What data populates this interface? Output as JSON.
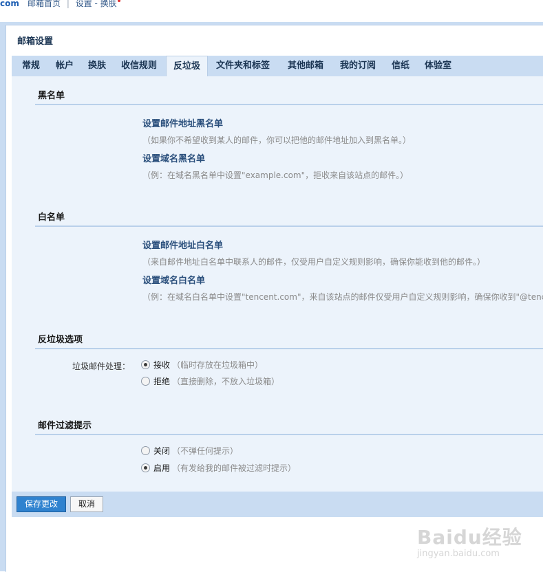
{
  "topbar": {
    "logo_tail": "com",
    "nav": [
      "邮箱首页",
      "设置 - 换肤"
    ],
    "separator": "|"
  },
  "page_title": "邮箱设置",
  "tabs": [
    {
      "label": "常规",
      "active": false
    },
    {
      "label": "帐户",
      "active": false
    },
    {
      "label": "换肤",
      "active": false
    },
    {
      "label": "收信规则",
      "active": false
    },
    {
      "label": "反垃圾",
      "active": true
    },
    {
      "label": "文件夹和标签",
      "active": false
    },
    {
      "label": "其他邮箱",
      "active": false
    },
    {
      "label": "我的订阅",
      "active": false
    },
    {
      "label": "信纸",
      "active": false
    },
    {
      "label": "体验室",
      "active": false
    }
  ],
  "blacklist": {
    "title": "黑名单",
    "address_link": "设置邮件地址黑名单",
    "address_hint": "（如果你不希望收到某人的邮件，你可以把他的邮件地址加入到黑名单。）",
    "domain_link": "设置域名黑名单",
    "domain_hint": "（例：在域名黑名单中设置\"example.com\"，拒收来自该站点的邮件。）"
  },
  "whitelist": {
    "title": "白名单",
    "address_link": "设置邮件地址白名单",
    "address_hint": "（来自邮件地址白名单中联系人的邮件，仅受用户自定义规则影响，确保你能收到他的邮件。）",
    "domain_link": "设置域名白名单",
    "domain_hint": "（例：在域名白名单中设置\"tencent.com\"，来自该站点的邮件仅受用户自定义规则影响，确保你收到\"@tence"
  },
  "antispam": {
    "title": "反垃圾选项",
    "label": "垃圾邮件处理：",
    "options": [
      {
        "label": "接收",
        "note": "（临时存放在垃圾箱中）",
        "checked": true
      },
      {
        "label": "拒绝",
        "note": "（直接删除，不放入垃圾箱）",
        "checked": false
      }
    ]
  },
  "filter_tip": {
    "title": "邮件过滤提示",
    "options": [
      {
        "label": "关闭",
        "note": "（不弹任何提示）",
        "checked": false
      },
      {
        "label": "启用",
        "note": "（有发给我的邮件被过滤时提示）",
        "checked": true
      }
    ]
  },
  "buttons": {
    "save": "保存更改",
    "cancel": "取消"
  },
  "watermark": {
    "main": "Baidu经验",
    "sub": "jingyan.baidu.com"
  },
  "colors": {
    "accent": "#2f82cf",
    "tab_bar": "#c9dcf2",
    "content_bg": "#ecf3fb",
    "link": "#2a4f7c"
  }
}
